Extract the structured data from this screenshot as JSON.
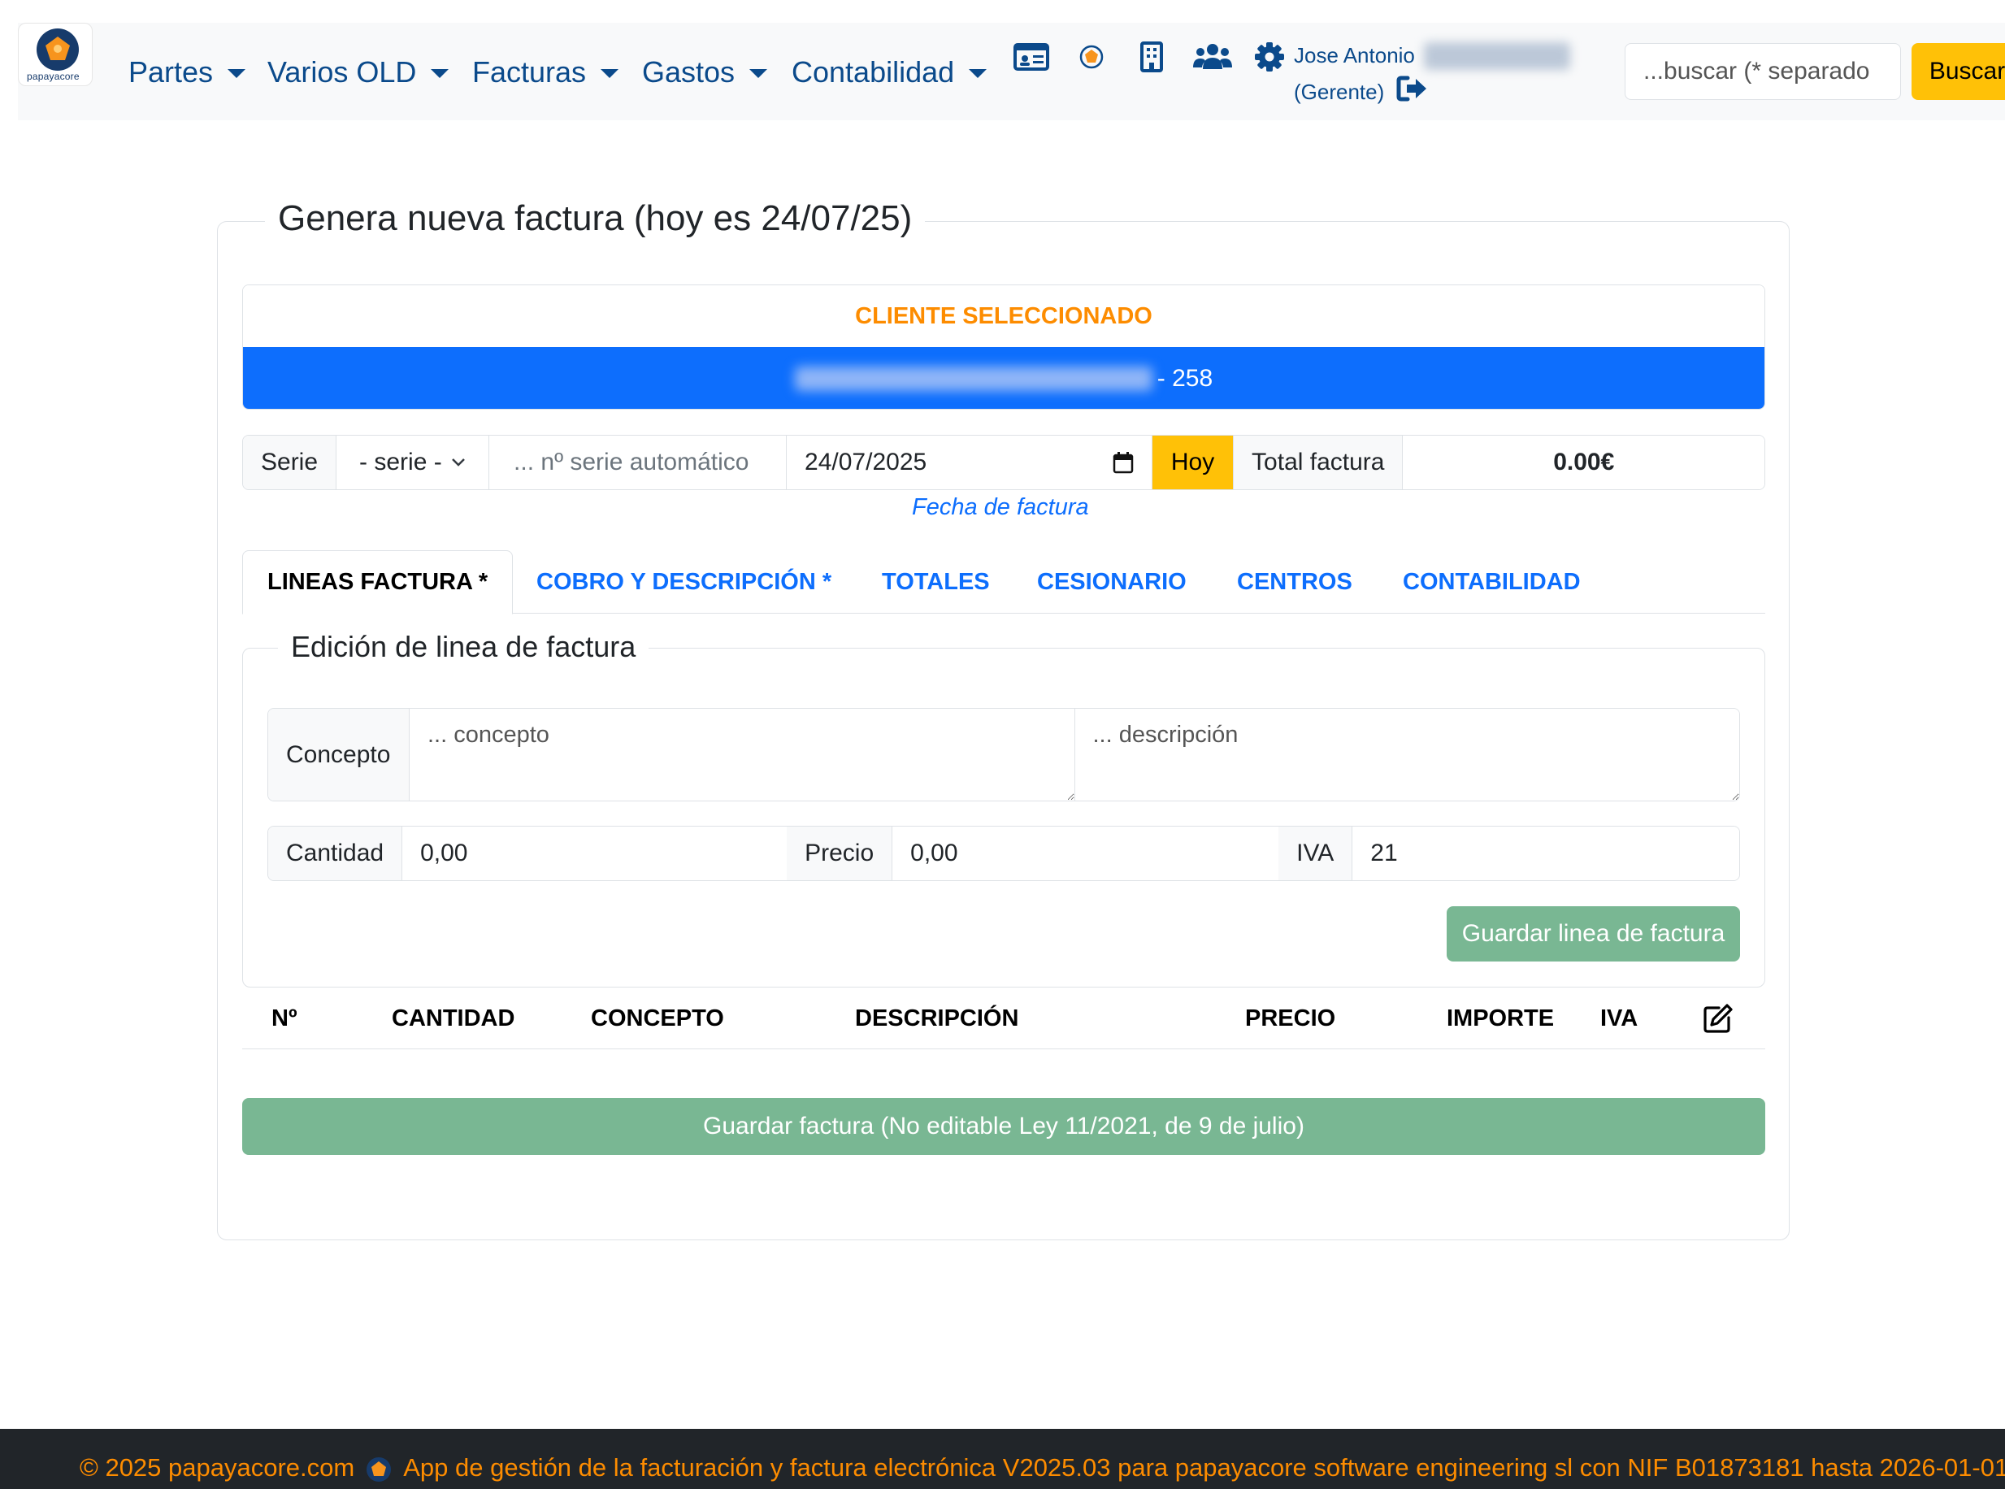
{
  "brand": {
    "wordmark": "papayacore"
  },
  "nav": {
    "menus": [
      {
        "label": "Partes"
      },
      {
        "label": "Varios OLD"
      },
      {
        "label": "Facturas"
      },
      {
        "label": "Gastos"
      },
      {
        "label": "Contabilidad"
      }
    ],
    "icons": [
      "id-card-icon",
      "papaya-logo-icon",
      "building-icon",
      "users-icon",
      "gear-icon"
    ],
    "user": {
      "name": "Jose Antonio",
      "role": "(Gerente)"
    },
    "search": {
      "placeholder": "...buscar (* separado",
      "button_label": "Buscar"
    }
  },
  "page": {
    "title": "Genera nueva factura (hoy es 24/07/25)",
    "client": {
      "heading": "CLIENTE SELECCIONADO",
      "suffix": "- 258"
    },
    "serie": {
      "label": "Serie",
      "select_value": "- serie -",
      "number_placeholder": "... nº serie automático",
      "date_value": "24/07/2025",
      "today_button": "Hoy",
      "total_label": "Total factura",
      "total_value": "0.00€",
      "date_caption": "Fecha de factura"
    },
    "tabs": [
      {
        "label": "LINEAS FACTURA *",
        "active": true
      },
      {
        "label": "COBRO Y DESCRIPCIÓN *"
      },
      {
        "label": "TOTALES"
      },
      {
        "label": "CESIONARIO"
      },
      {
        "label": "CENTROS"
      },
      {
        "label": "CONTABILIDAD"
      }
    ],
    "line_edit": {
      "title": "Edición de linea de factura",
      "concepto_label": "Concepto",
      "concepto_placeholder": "... concepto",
      "descripcion_placeholder": "... descripción",
      "cantidad_label": "Cantidad",
      "cantidad_value": "0,00",
      "precio_label": "Precio",
      "precio_value": "0,00",
      "iva_label": "IVA",
      "iva_value": "21",
      "save_button": "Guardar linea de factura"
    },
    "table": {
      "headers": [
        "Nº",
        "CANTIDAD",
        "CONCEPTO",
        "DESCRIPCIÓN",
        "PRECIO",
        "IMPORTE",
        "IVA"
      ],
      "edit_icon": "edit-icon"
    },
    "save_invoice_button": "Guardar factura (No editable Ley 11/2021, de 9 de julio)"
  },
  "footer": {
    "copyright": "© 2025 papayacore.com",
    "text": "App de gestión de la facturación y factura electrónica V2025.03 para papayacore software engineering sl con NIF B01873181 hasta 2026-01-01"
  },
  "colors": {
    "nav_text": "#0b4a8b",
    "accent_orange": "#fd8c00",
    "primary": "#0d6efd",
    "warning": "#ffc107",
    "success_muted": "#79b793",
    "footer_bg": "#212529"
  }
}
